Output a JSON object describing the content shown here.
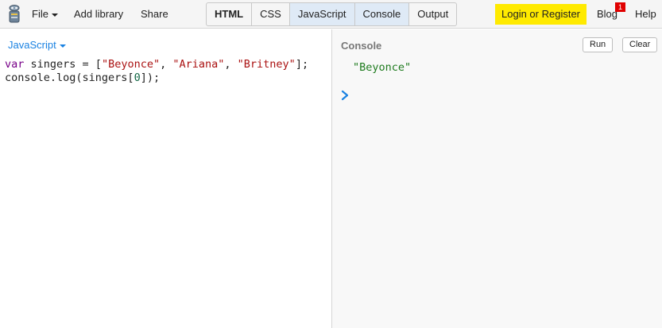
{
  "toolbar": {
    "file_label": "File",
    "add_library_label": "Add library",
    "share_label": "Share",
    "tabs": [
      {
        "label": "HTML",
        "bold": true,
        "active": false
      },
      {
        "label": "CSS",
        "bold": false,
        "active": false
      },
      {
        "label": "JavaScript",
        "bold": false,
        "active": true
      },
      {
        "label": "Console",
        "bold": false,
        "active": true
      },
      {
        "label": "Output",
        "bold": false,
        "active": false
      }
    ],
    "login_label": "Login or Register",
    "blog_label": "Blog",
    "blog_badge": "1",
    "help_label": "Help"
  },
  "editor": {
    "language": "JavaScript",
    "code_lines": [
      [
        {
          "t": "var",
          "c": "kw"
        },
        {
          "t": " singers = ["
        },
        {
          "t": "\"Beyonce\"",
          "c": "str"
        },
        {
          "t": ", "
        },
        {
          "t": "\"Ariana\"",
          "c": "str"
        },
        {
          "t": ", "
        },
        {
          "t": "\"Britney\"",
          "c": "str"
        },
        {
          "t": "];"
        }
      ],
      [
        {
          "t": "console.log(singers["
        },
        {
          "t": "0",
          "c": "num"
        },
        {
          "t": "]);"
        }
      ]
    ]
  },
  "console": {
    "title": "Console",
    "run_label": "Run",
    "clear_label": "Clear",
    "output": "\"Beyonce\""
  },
  "colors": {
    "accent": "#1a82e2",
    "login_bg": "#ffea00",
    "badge_bg": "#e00000",
    "string_output": "#1e7b1e"
  },
  "icons": {
    "logo": "jsbin-robot-icon",
    "prompt": "chevron-right-icon"
  }
}
